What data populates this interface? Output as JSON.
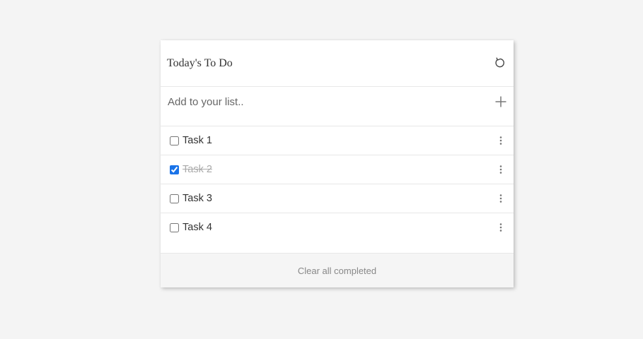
{
  "app": {
    "title": "Today's To Do",
    "refresh_icon": "refresh-icon"
  },
  "add": {
    "placeholder": "Add to your list..",
    "value": "",
    "icon": "plus-icon"
  },
  "tasks": [
    {
      "label": "Task 1",
      "completed": false
    },
    {
      "label": "Task 2",
      "completed": true
    },
    {
      "label": "Task 3",
      "completed": false
    },
    {
      "label": "Task 4",
      "completed": false
    }
  ],
  "task_menu_icon": "more-vertical-icon",
  "footer": {
    "clear_label": "Clear all completed"
  },
  "colors": {
    "page_bg": "#f4f4f4",
    "card_bg": "#ffffff",
    "checkbox_accent": "#1a73e8",
    "completed_text": "#aaaaaa",
    "footer_bg": "#f5f5f5"
  }
}
